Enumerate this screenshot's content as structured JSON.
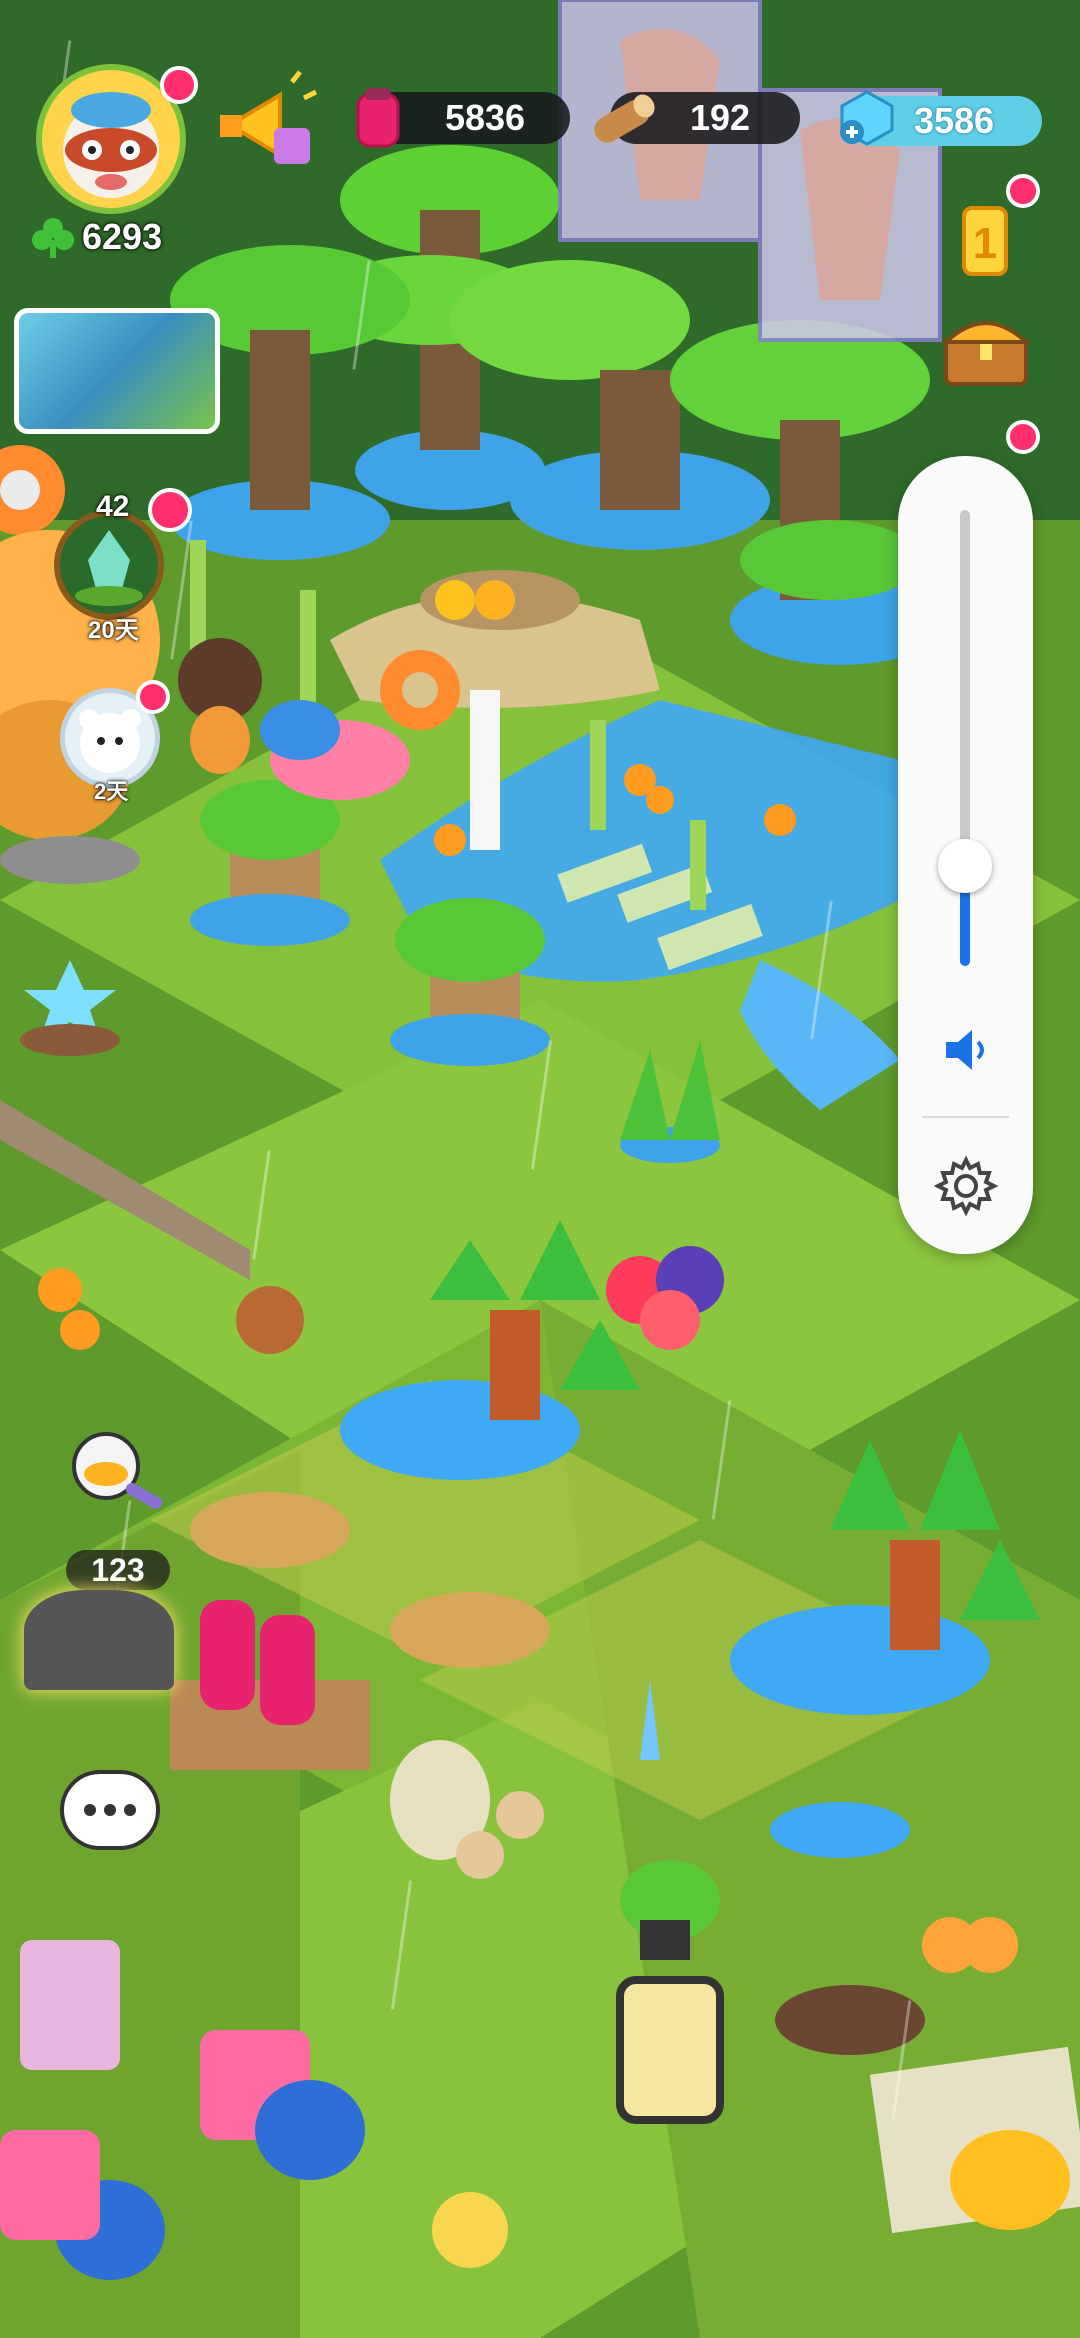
{
  "hud": {
    "player_score": "6293",
    "potion_count": "5836",
    "wood_count": "192",
    "gem_count": "3586",
    "level_badge": "42",
    "timer_badge_1": "20天",
    "timer_badge_2": "2天",
    "robot_count": "123"
  },
  "volume": {
    "level": 0.22
  },
  "colors": {
    "grass": "#7cb83a",
    "water": "#3fa9f5",
    "accent_red": "#ff2f6d",
    "slider_blue": "#1a73e8"
  },
  "icons": {
    "speaker": "speaker-icon",
    "settings": "gear-icon",
    "club": "club-icon"
  }
}
